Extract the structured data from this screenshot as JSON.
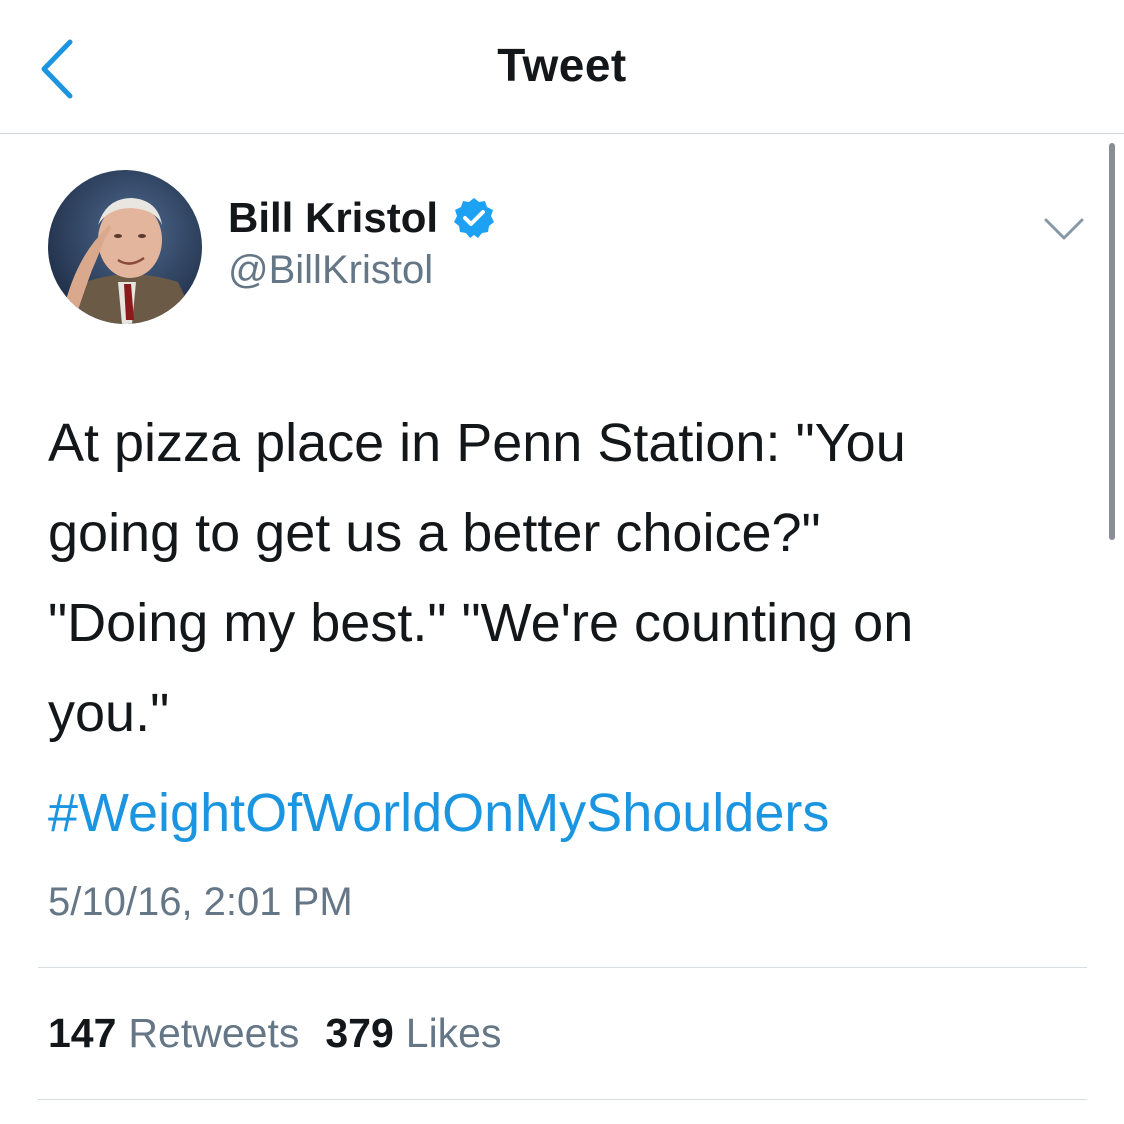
{
  "navbar": {
    "title": "Tweet",
    "back_icon": "chevron-left-icon",
    "accent_color": "#1b95e0"
  },
  "author": {
    "name": "Bill Kristol",
    "handle": "@BillKristol",
    "verified": true,
    "verified_color": "#1da1f2"
  },
  "tweet": {
    "text": "At pizza place in Penn Station: \"You\ngoing to get us a better choice?\"\n\"Doing my best.\" \"We're counting on\nyou.\"",
    "hashtag": "#WeightOfWorldOnMyShoulders",
    "timestamp": "5/10/16, 2:01 PM"
  },
  "stats": {
    "retweets_count": "147",
    "retweets_label": "Retweets",
    "likes_count": "379",
    "likes_label": "Likes"
  }
}
